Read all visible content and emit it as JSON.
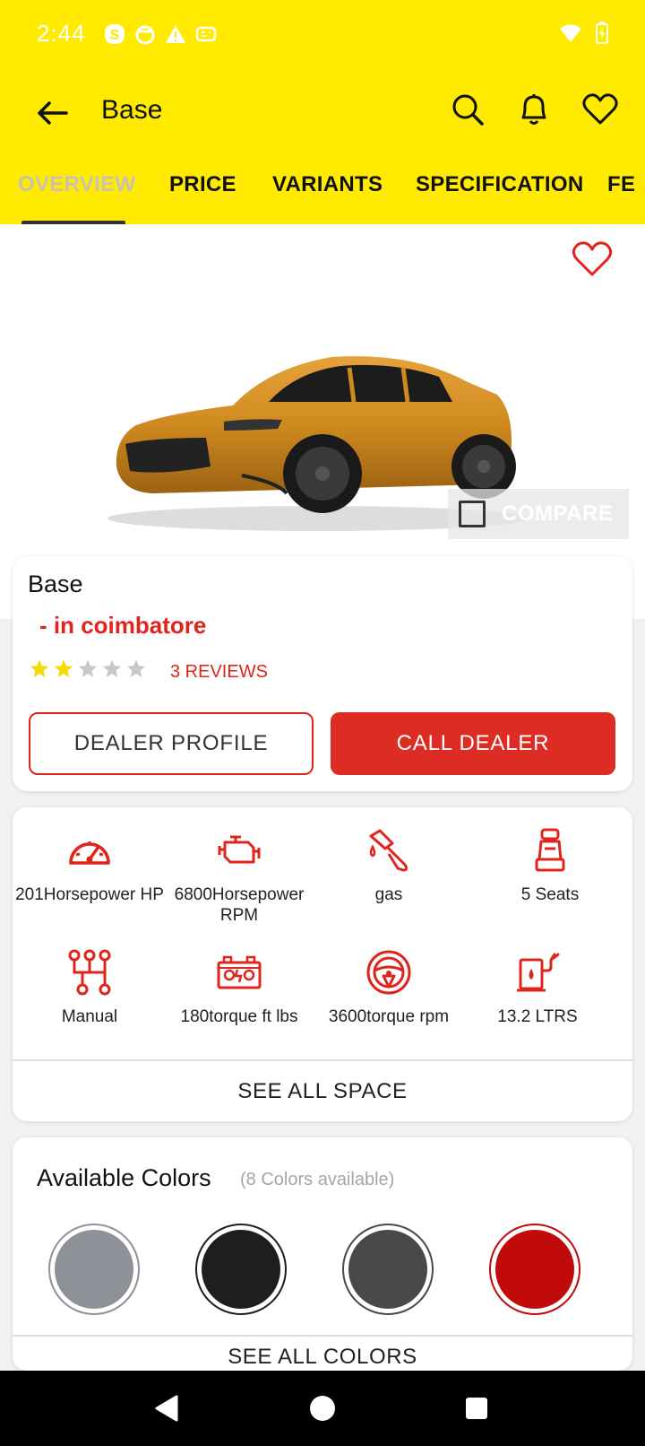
{
  "status": {
    "time": "2:44"
  },
  "appbar": {
    "title": "Base"
  },
  "tabs": [
    {
      "label": "OVERVIEW"
    },
    {
      "label": "PRICE"
    },
    {
      "label": "VARIANTS"
    },
    {
      "label": "SPECIFICATION"
    },
    {
      "label": "FE"
    }
  ],
  "hero": {
    "compare_label": "COMPARE"
  },
  "info": {
    "model": "Base",
    "location": "- in coimbatore",
    "rating": 2,
    "rating_max": 5,
    "reviews": "3 REVIEWS",
    "dealer_profile": "DEALER PROFILE",
    "call_dealer": "CALL DEALER"
  },
  "specs": [
    {
      "icon": "speedometer-icon",
      "label": "201Horsepower HP"
    },
    {
      "icon": "engine-icon",
      "label": "6800Horsepower RPM"
    },
    {
      "icon": "fuel-nozzle-icon",
      "label": "gas"
    },
    {
      "icon": "seat-icon",
      "label": "5 Seats"
    },
    {
      "icon": "gear-shift-icon",
      "label": "Manual"
    },
    {
      "icon": "battery-icon",
      "label": "180torque ft lbs"
    },
    {
      "icon": "steering-wheel-icon",
      "label": "3600torque rpm"
    },
    {
      "icon": "fuel-station-icon",
      "label": "13.2 LTRS"
    }
  ],
  "see_all_space": "SEE ALL SPACE",
  "colors": {
    "title": "Available Colors",
    "subtitle": "(8 Colors available)",
    "swatches": [
      "#8e9298",
      "#1e1e1e",
      "#48494b",
      "#c10a0a"
    ],
    "see_all": "SEE ALL COLORS"
  },
  "theme": {
    "accent": "#ffea00",
    "red": "#e0241b",
    "star_on": "#f5d90a",
    "star_off": "#c8c8c8"
  }
}
